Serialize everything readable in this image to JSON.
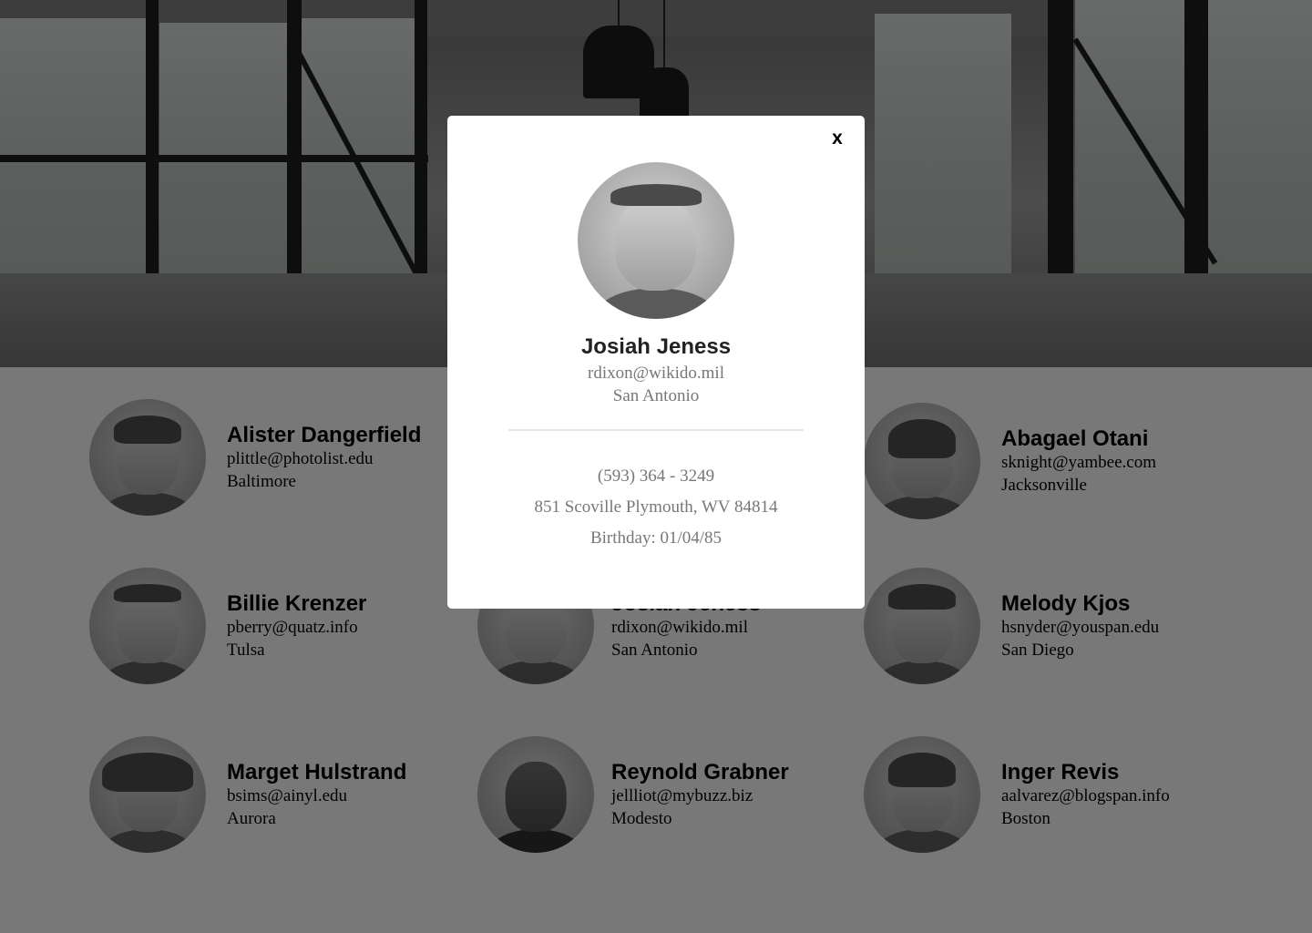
{
  "employees": [
    {
      "name": "Alister Dangerfield",
      "email": "plittle@photolist.edu",
      "city": "Baltimore"
    },
    {
      "name": "Abagael Otani",
      "email": "sknight@yambee.com",
      "city": "Jacksonville"
    },
    {
      "name": "Billie Krenzer",
      "email": "pberry@quatz.info",
      "city": "Tulsa"
    },
    {
      "name": "Josiah Jeness",
      "email": "rdixon@wikido.mil",
      "city": "San Antonio"
    },
    {
      "name": "Melody Kjos",
      "email": "hsnyder@youspan.edu",
      "city": "San Diego"
    },
    {
      "name": "Marget Hulstrand",
      "email": "bsims@ainyl.edu",
      "city": "Aurora"
    },
    {
      "name": "Reynold Grabner",
      "email": "jellliot@mybuzz.biz",
      "city": "Modesto"
    },
    {
      "name": "Inger Revis",
      "email": "aalvarez@blogspan.info",
      "city": "Boston"
    }
  ],
  "modal": {
    "close_label": "x",
    "name": "Josiah Jeness",
    "email": "rdixon@wikido.mil",
    "city": "San Antonio",
    "phone": "(593) 364 - 3249",
    "address": "851 Scoville Plymouth, WV 84814",
    "birthday": "Birthday: 01/04/85"
  },
  "colors": {
    "overlay": "#000000",
    "modal_background": "#ffffff",
    "modal_secondary_text": "#777777"
  }
}
